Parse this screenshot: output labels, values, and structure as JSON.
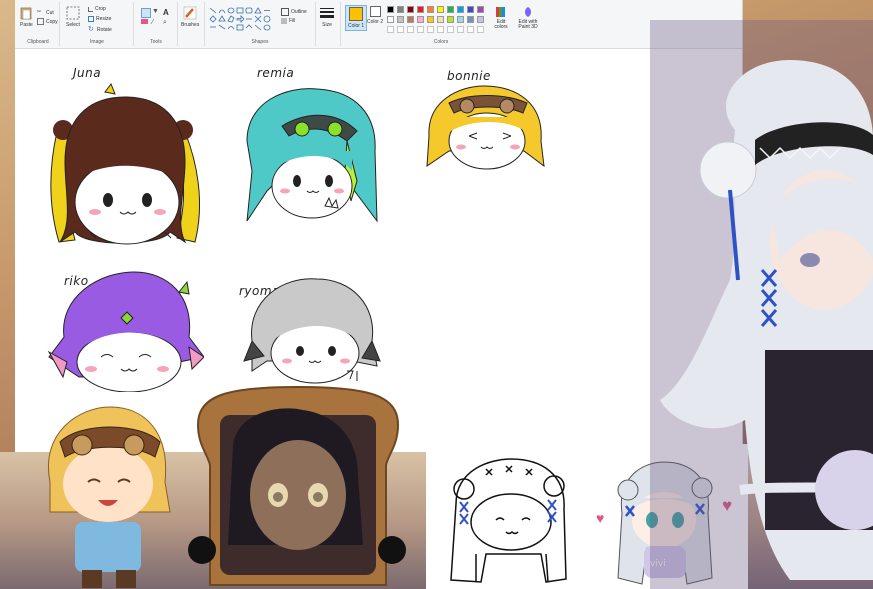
{
  "ribbon": {
    "clipboard": {
      "paste_label": "Paste",
      "cut_label": "Cut",
      "copy_label": "Copy",
      "group_label": "Clipboard"
    },
    "image": {
      "select_label": "Select",
      "crop_label": "Crop",
      "resize_label": "Resize",
      "rotate_label": "Rotate",
      "group_label": "Image"
    },
    "tools": {
      "group_label": "Tools"
    },
    "brushes_label": "Brushes",
    "shapes": {
      "outline_label": "Outline",
      "fill_label": "Fill",
      "group_label": "Shapes"
    },
    "size_label": "Size",
    "color1_label": "Color 1",
    "color2_label": "Color 2",
    "colors_group_label": "Colors",
    "edit_colors_label": "Edit colors",
    "edit_paint3d_label": "Edit with Paint 3D",
    "color1_value": "#ffc000",
    "color2_value": "#ffffff",
    "palette_row1": [
      "#000000",
      "#7f7f7f",
      "#880015",
      "#ed1c24",
      "#ff7f27",
      "#fff200",
      "#22b14c",
      "#00a2e8",
      "#3f48cc",
      "#a349a4"
    ],
    "palette_row2": [
      "#ffffff",
      "#c3c3c3",
      "#b97a57",
      "#ffaec9",
      "#ffc90e",
      "#efe4b0",
      "#b5e61d",
      "#99d9ea",
      "#7092be",
      "#c8bfe7"
    ]
  },
  "canvas": {
    "labels": [
      "Juna",
      "remia",
      "bonnie",
      "riko",
      "ryoma"
    ]
  },
  "overlays": {
    "mug_text": "vivi"
  }
}
